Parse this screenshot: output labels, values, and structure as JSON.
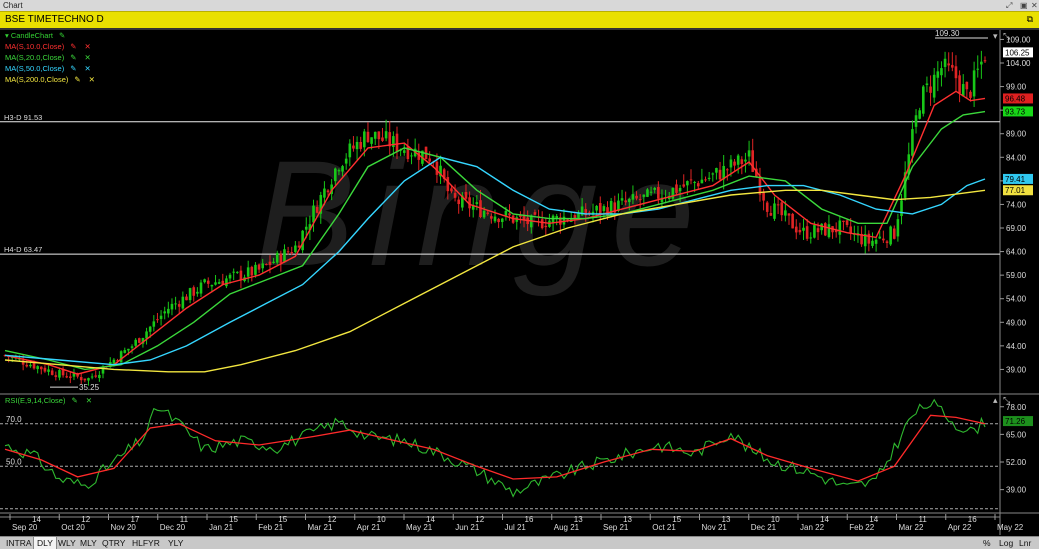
{
  "window": {
    "title": "Chart"
  },
  "symbol": {
    "name": "BSE TIMETECHNO D"
  },
  "legend": [
    {
      "label": "CandleChart",
      "color": "#33d133",
      "pen": false,
      "close": false
    },
    {
      "label": "MA(S,10.0,Close)",
      "color": "#ff3030",
      "pen": true,
      "close": true
    },
    {
      "label": "MA(S,20.0,Close)",
      "color": "#3bd83b",
      "pen": true,
      "close": true
    },
    {
      "label": "MA(S,50.0,Close)",
      "color": "#35d6ff",
      "pen": true,
      "close": true
    },
    {
      "label": "MA(S,200.0,Close)",
      "color": "#f2e640",
      "pen": true,
      "close": true
    }
  ],
  "icons": {
    "pen": "pencil-icon",
    "close": "close-x-icon",
    "triangle": "collapse-triangle-icon",
    "resize": "resize-icon",
    "window": "restore-window-icon",
    "pin": "pin-icon"
  },
  "rsi_legend": {
    "label": "RSI(E,9,14,Close)",
    "color": "#3bd83b"
  },
  "chart_data": {
    "type": "candlestick",
    "title": "BSE TIMETECHNO D",
    "price_axis": {
      "ticks": [
        "109.00",
        "104.00",
        "99.00",
        "94.00",
        "89.00",
        "84.00",
        "79.00",
        "74.00",
        "69.00",
        "64.00",
        "59.00",
        "54.00",
        "49.00",
        "44.00",
        "39.00"
      ],
      "ylim": [
        34,
        111
      ]
    },
    "price_labels": [
      {
        "text": "106.25",
        "value": 106.25,
        "bg": "#ffffff",
        "fg": "#000000"
      },
      {
        "text": "96.48",
        "value": 96.48,
        "bg": "#e02020",
        "fg": "#000000"
      },
      {
        "text": "93.73",
        "value": 93.73,
        "bg": "#18d818",
        "fg": "#000000"
      },
      {
        "text": "79.41",
        "value": 79.41,
        "bg": "#30c8f0",
        "fg": "#000000"
      },
      {
        "text": "77.01",
        "value": 77.01,
        "bg": "#f0e040",
        "fg": "#000000"
      }
    ],
    "hlines": [
      {
        "label": "H3-D 91.53",
        "value": 91.53
      },
      {
        "label": "H4-D 63.47",
        "value": 63.47
      }
    ],
    "annotations": [
      {
        "text": "109.30",
        "value": 109.3
      },
      {
        "text": "35.25",
        "value": 35.25
      }
    ],
    "x_ticks": {
      "days": [
        "14",
        "12",
        "17",
        "11",
        "15",
        "15",
        "12",
        "10",
        "14",
        "12",
        "16",
        "13",
        "13",
        "15",
        "13",
        "10",
        "14",
        "14",
        "11",
        "16"
      ],
      "months": [
        "Sep 20",
        "Oct 20",
        "Nov 20",
        "Dec 20",
        "Jan 21",
        "Feb 21",
        "Mar 21",
        "Apr 21",
        "May 21",
        "Jun 21",
        "Jul 21",
        "Aug 21",
        "Sep 21",
        "Oct 21",
        "Nov 21",
        "Dec 21",
        "Jan 22",
        "Feb 22",
        "Mar 22",
        "Apr 22",
        "May 22"
      ]
    },
    "price_path": [
      [
        0,
        42
      ],
      [
        15,
        38
      ],
      [
        23,
        37
      ],
      [
        35,
        44
      ],
      [
        45,
        52
      ],
      [
        55,
        57
      ],
      [
        70,
        60
      ],
      [
        80,
        65
      ],
      [
        92,
        83
      ],
      [
        100,
        89
      ],
      [
        110,
        86
      ],
      [
        118,
        84
      ],
      [
        123,
        75
      ],
      [
        135,
        72
      ],
      [
        145,
        70
      ],
      [
        160,
        72
      ],
      [
        170,
        74
      ],
      [
        180,
        76
      ],
      [
        195,
        80
      ],
      [
        205,
        84
      ],
      [
        210,
        74
      ],
      [
        220,
        68
      ],
      [
        230,
        69
      ],
      [
        238,
        66
      ],
      [
        245,
        68
      ],
      [
        252,
        96
      ],
      [
        258,
        103
      ],
      [
        262,
        101
      ],
      [
        265,
        97
      ],
      [
        267,
        100
      ],
      [
        270,
        106
      ]
    ],
    "ma_series": [
      {
        "name": "MA(S,10.0,Close)",
        "color": "#ff3030",
        "values": [
          [
            0,
            42
          ],
          [
            12,
            40
          ],
          [
            20,
            38
          ],
          [
            30,
            40
          ],
          [
            40,
            46
          ],
          [
            50,
            52
          ],
          [
            60,
            57
          ],
          [
            70,
            59
          ],
          [
            80,
            63
          ],
          [
            90,
            77
          ],
          [
            100,
            86
          ],
          [
            110,
            87
          ],
          [
            118,
            82
          ],
          [
            128,
            74
          ],
          [
            140,
            71
          ],
          [
            150,
            70
          ],
          [
            160,
            71
          ],
          [
            170,
            73
          ],
          [
            180,
            75
          ],
          [
            195,
            78
          ],
          [
            205,
            83
          ],
          [
            212,
            76
          ],
          [
            222,
            70
          ],
          [
            232,
            68
          ],
          [
            240,
            67
          ],
          [
            248,
            80
          ],
          [
            256,
            95
          ],
          [
            262,
            98
          ],
          [
            266,
            96
          ],
          [
            270,
            96.5
          ]
        ]
      },
      {
        "name": "MA(S,20.0,Close)",
        "color": "#3bd83b",
        "values": [
          [
            0,
            43
          ],
          [
            12,
            41
          ],
          [
            22,
            39
          ],
          [
            32,
            40
          ],
          [
            42,
            44
          ],
          [
            52,
            49
          ],
          [
            62,
            55
          ],
          [
            72,
            58
          ],
          [
            82,
            61
          ],
          [
            92,
            72
          ],
          [
            100,
            82
          ],
          [
            110,
            86
          ],
          [
            120,
            84
          ],
          [
            130,
            77
          ],
          [
            140,
            72
          ],
          [
            150,
            71
          ],
          [
            160,
            71
          ],
          [
            170,
            72
          ],
          [
            180,
            74
          ],
          [
            195,
            77
          ],
          [
            205,
            80
          ],
          [
            215,
            79
          ],
          [
            225,
            73
          ],
          [
            235,
            70
          ],
          [
            243,
            70
          ],
          [
            250,
            82
          ],
          [
            258,
            90
          ],
          [
            264,
            93
          ],
          [
            270,
            93.7
          ]
        ]
      },
      {
        "name": "MA(S,50.0,Close)",
        "color": "#35d6ff",
        "values": [
          [
            0,
            42
          ],
          [
            15,
            41
          ],
          [
            30,
            40
          ],
          [
            40,
            41
          ],
          [
            50,
            44
          ],
          [
            62,
            49
          ],
          [
            72,
            53
          ],
          [
            82,
            57
          ],
          [
            92,
            64
          ],
          [
            100,
            71
          ],
          [
            110,
            79
          ],
          [
            120,
            84
          ],
          [
            130,
            82
          ],
          [
            140,
            77
          ],
          [
            150,
            73
          ],
          [
            160,
            72
          ],
          [
            170,
            72
          ],
          [
            180,
            73
          ],
          [
            190,
            75
          ],
          [
            200,
            77
          ],
          [
            210,
            78
          ],
          [
            220,
            78
          ],
          [
            230,
            76
          ],
          [
            240,
            73
          ],
          [
            250,
            72
          ],
          [
            258,
            74
          ],
          [
            265,
            78
          ],
          [
            270,
            79.4
          ]
        ]
      },
      {
        "name": "MA(S,200.0,Close)",
        "color": "#f2e640",
        "values": [
          [
            0,
            41
          ],
          [
            15,
            40
          ],
          [
            30,
            39
          ],
          [
            45,
            38.5
          ],
          [
            55,
            38.5
          ],
          [
            65,
            40
          ],
          [
            80,
            43
          ],
          [
            95,
            47
          ],
          [
            110,
            53
          ],
          [
            125,
            59
          ],
          [
            140,
            65
          ],
          [
            155,
            69
          ],
          [
            170,
            72
          ],
          [
            185,
            74
          ],
          [
            200,
            76
          ],
          [
            215,
            77
          ],
          [
            225,
            77
          ],
          [
            235,
            76
          ],
          [
            245,
            75
          ],
          [
            255,
            75.5
          ],
          [
            270,
            77
          ]
        ]
      }
    ],
    "rsi": {
      "ticks": [
        "78.00",
        "65.00",
        "52.00",
        "39.00"
      ],
      "ylim": [
        28,
        84
      ],
      "levels": [
        {
          "label": "70.0",
          "value": 70
        },
        {
          "label": "50.0",
          "value": 50
        },
        {
          "value": 30
        }
      ],
      "value_label": {
        "text": "71.26",
        "value": 71.26
      },
      "rsi_line": [
        [
          0,
          60
        ],
        [
          8,
          55
        ],
        [
          15,
          44
        ],
        [
          22,
          41
        ],
        [
          30,
          52
        ],
        [
          38,
          63
        ],
        [
          42,
          78
        ],
        [
          48,
          70
        ],
        [
          55,
          58
        ],
        [
          65,
          62
        ],
        [
          75,
          59
        ],
        [
          85,
          66
        ],
        [
          92,
          71
        ],
        [
          100,
          64
        ],
        [
          110,
          62
        ],
        [
          120,
          56
        ],
        [
          130,
          48
        ],
        [
          140,
          38
        ],
        [
          150,
          44
        ],
        [
          160,
          50
        ],
        [
          170,
          55
        ],
        [
          180,
          60
        ],
        [
          190,
          56
        ],
        [
          200,
          66
        ],
        [
          205,
          58
        ],
        [
          212,
          52
        ],
        [
          222,
          47
        ],
        [
          232,
          40
        ],
        [
          240,
          43
        ],
        [
          250,
          74
        ],
        [
          255,
          80
        ],
        [
          262,
          70
        ],
        [
          266,
          66
        ],
        [
          270,
          71
        ]
      ],
      "signal_line": [
        [
          0,
          58
        ],
        [
          10,
          53
        ],
        [
          20,
          45
        ],
        [
          30,
          49
        ],
        [
          40,
          68
        ],
        [
          48,
          70
        ],
        [
          58,
          62
        ],
        [
          70,
          60
        ],
        [
          85,
          64
        ],
        [
          95,
          67
        ],
        [
          105,
          63
        ],
        [
          118,
          58
        ],
        [
          130,
          50
        ],
        [
          140,
          44
        ],
        [
          152,
          45
        ],
        [
          165,
          52
        ],
        [
          178,
          58
        ],
        [
          190,
          57
        ],
        [
          200,
          63
        ],
        [
          210,
          55
        ],
        [
          222,
          49
        ],
        [
          235,
          43
        ],
        [
          245,
          50
        ],
        [
          255,
          74
        ],
        [
          262,
          73
        ],
        [
          270,
          70
        ]
      ]
    }
  },
  "bottom_tabs": [
    "INTRA",
    "DLY",
    "WLY",
    "MLY",
    "QTRY",
    "HLFYR",
    "YLY"
  ],
  "bottom_selected": "DLY",
  "bottom_right": [
    "%",
    "Log",
    "Lnr"
  ],
  "watermark": "Binge"
}
